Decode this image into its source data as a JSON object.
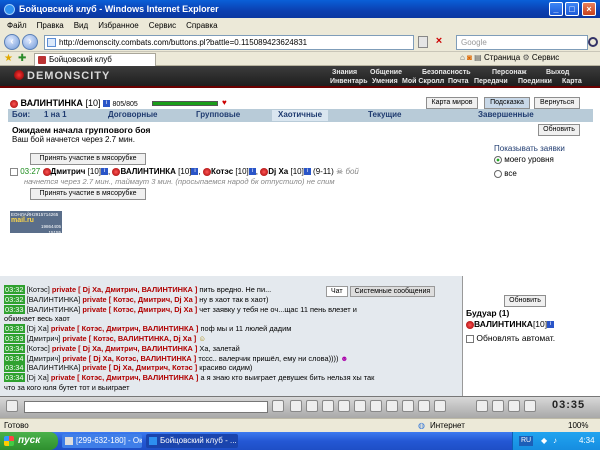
{
  "window": {
    "title": "Бойцовский клуб - Windows Internet Explorer"
  },
  "menu": [
    "Файл",
    "Правка",
    "Вид",
    "Избранное",
    "Сервис",
    "Справка"
  ],
  "address": {
    "url": "http://demonscity.combats.com/buttons.pl?battle=0.115089423624831",
    "search_placeholder": "Google"
  },
  "tab": {
    "label": "Бойцовский клуб",
    "tools": [
      "Страница",
      "Сервис"
    ]
  },
  "game": {
    "logo": "DEMONSCITY",
    "top_menu": [
      "Знания",
      "Общение",
      "Безопасность",
      "Персонаж",
      "Выход"
    ],
    "sub_menu": [
      "Инвентарь",
      "Умения",
      "Мой Скролл",
      "Почта",
      "Передачи",
      "Поединки",
      "Карта"
    ],
    "player": {
      "name": "ВАЛИНТИНКА",
      "level": "[10]",
      "hp": "805/805"
    },
    "buttons": {
      "map": "Карта миров",
      "hint": "Подсказка",
      "back": "Вернуться",
      "refresh": "Обновить",
      "join": "Принять участие в мясорубке"
    },
    "tabs": {
      "label": "Бои:",
      "items": [
        "1 на 1",
        "Договорные",
        "Групповые",
        "Хаотичные",
        "Текущие",
        "Завершенные"
      ],
      "active": 3
    },
    "status": {
      "title": "Ожидаем начала группового боя",
      "sub": "Ваш бой начнется через 2.7 мин."
    },
    "show_apps": {
      "label": "Показывать заявки",
      "opt1": "моего уровня",
      "opt2": "все"
    },
    "request": {
      "time": "03:27",
      "p1": "Дмитрич",
      "p1lv": "[10]",
      "p2": "ВАЛИНТИНКА",
      "p2lv": "[10]",
      "p3": "Котэс",
      "p3lv": "[10]",
      "p4": "Dj Xa",
      "p4lv": "[10]",
      "range": "(9-11)",
      "tail": "бой",
      "note": "начнется через 2.7 мин., таймаут 3 мин. (просыпаемся народ бк отпустило) не спим"
    },
    "counter": {
      "l1": "ЕОНЛАЙН2915714265",
      "l2": "mail.ru",
      "l3": "19864405",
      "l4": "15155"
    }
  },
  "chat": {
    "tabs": [
      "Чат",
      "Системные сообщения"
    ],
    "lines": [
      {
        "t": "03:32",
        "n": "[Котэс]",
        "p": "private [ Dj Xa, Дмитрич, ВАЛИНТИНКА ]",
        "m": "пить вредно. Не пи..."
      },
      {
        "t": "03:32",
        "n": "[ВАЛИНТИНКА]",
        "p": "private [ Котэс, Дмитрич, Dj Xa ]",
        "m": "ну в хаот так в хаот)"
      },
      {
        "t": "03:33",
        "n": "[ВАЛИНТИНКА]",
        "p": "private [ Котэс, Дмитрич, Dj Xa ]",
        "m": "чет заявку у тебя не оч...щас 11 пень влезет и"
      },
      {
        "t": "",
        "n": "",
        "p": "",
        "m": "обкинает весь хаот"
      },
      {
        "t": "03:33",
        "n": "[Dj Xa]",
        "p": "private [ Котэс, Дмитрич, ВАЛИНТИНКА ]",
        "m": "поф мы и 11 люлей дадим"
      },
      {
        "t": "03:33",
        "n": "[Дмитрич]",
        "p": "private [ Котэс, ВАЛИНТИНКА, Dj Xa ]",
        "m": ""
      },
      {
        "t": "03:34",
        "n": "[Котэс]",
        "p": "private [ Dj Xa, Дмитрич, ВАЛИНТИНКА ]",
        "m": "Ха, залетай"
      },
      {
        "t": "03:34",
        "n": "[Дмитрич]",
        "p": "private [ Dj Xa, Котэс, ВАЛИНТИНКА ]",
        "m": "тссс.. валерчик пришёл, ему ни слова))))"
      },
      {
        "t": "03:34",
        "n": "[ВАЛИНТИНКА]",
        "p": "private [ Dj Xa, Дмитрич, Котэс ]",
        "m": "красиво сидим)"
      },
      {
        "t": "03:34",
        "n": "[Dj Xa]",
        "p": "private [ Котэс, Дмитрич, ВАЛИНТИНКА ]",
        "m": "а я знаю кто выиграет девушек бить нельзя хы так"
      },
      {
        "t": "",
        "n": "",
        "p": "",
        "m": "что за кого юля бутет тот и выиграет"
      }
    ]
  },
  "side": {
    "refresh": "Обновить",
    "room": "Будуар (1)",
    "user": "ВАЛИНТИНКА",
    "userlv": "[10]",
    "auto": "Обновлять автомат."
  },
  "clock": "03:35",
  "statusbar": {
    "left": "Готово",
    "zone": "Интернет",
    "zoom": "100%"
  },
  "taskbar": {
    "start": "пуск",
    "items": [
      "[299-632-180] - Окн...",
      "Бойцовский клуб - ..."
    ],
    "time": "4:34",
    "lang": "RU"
  }
}
